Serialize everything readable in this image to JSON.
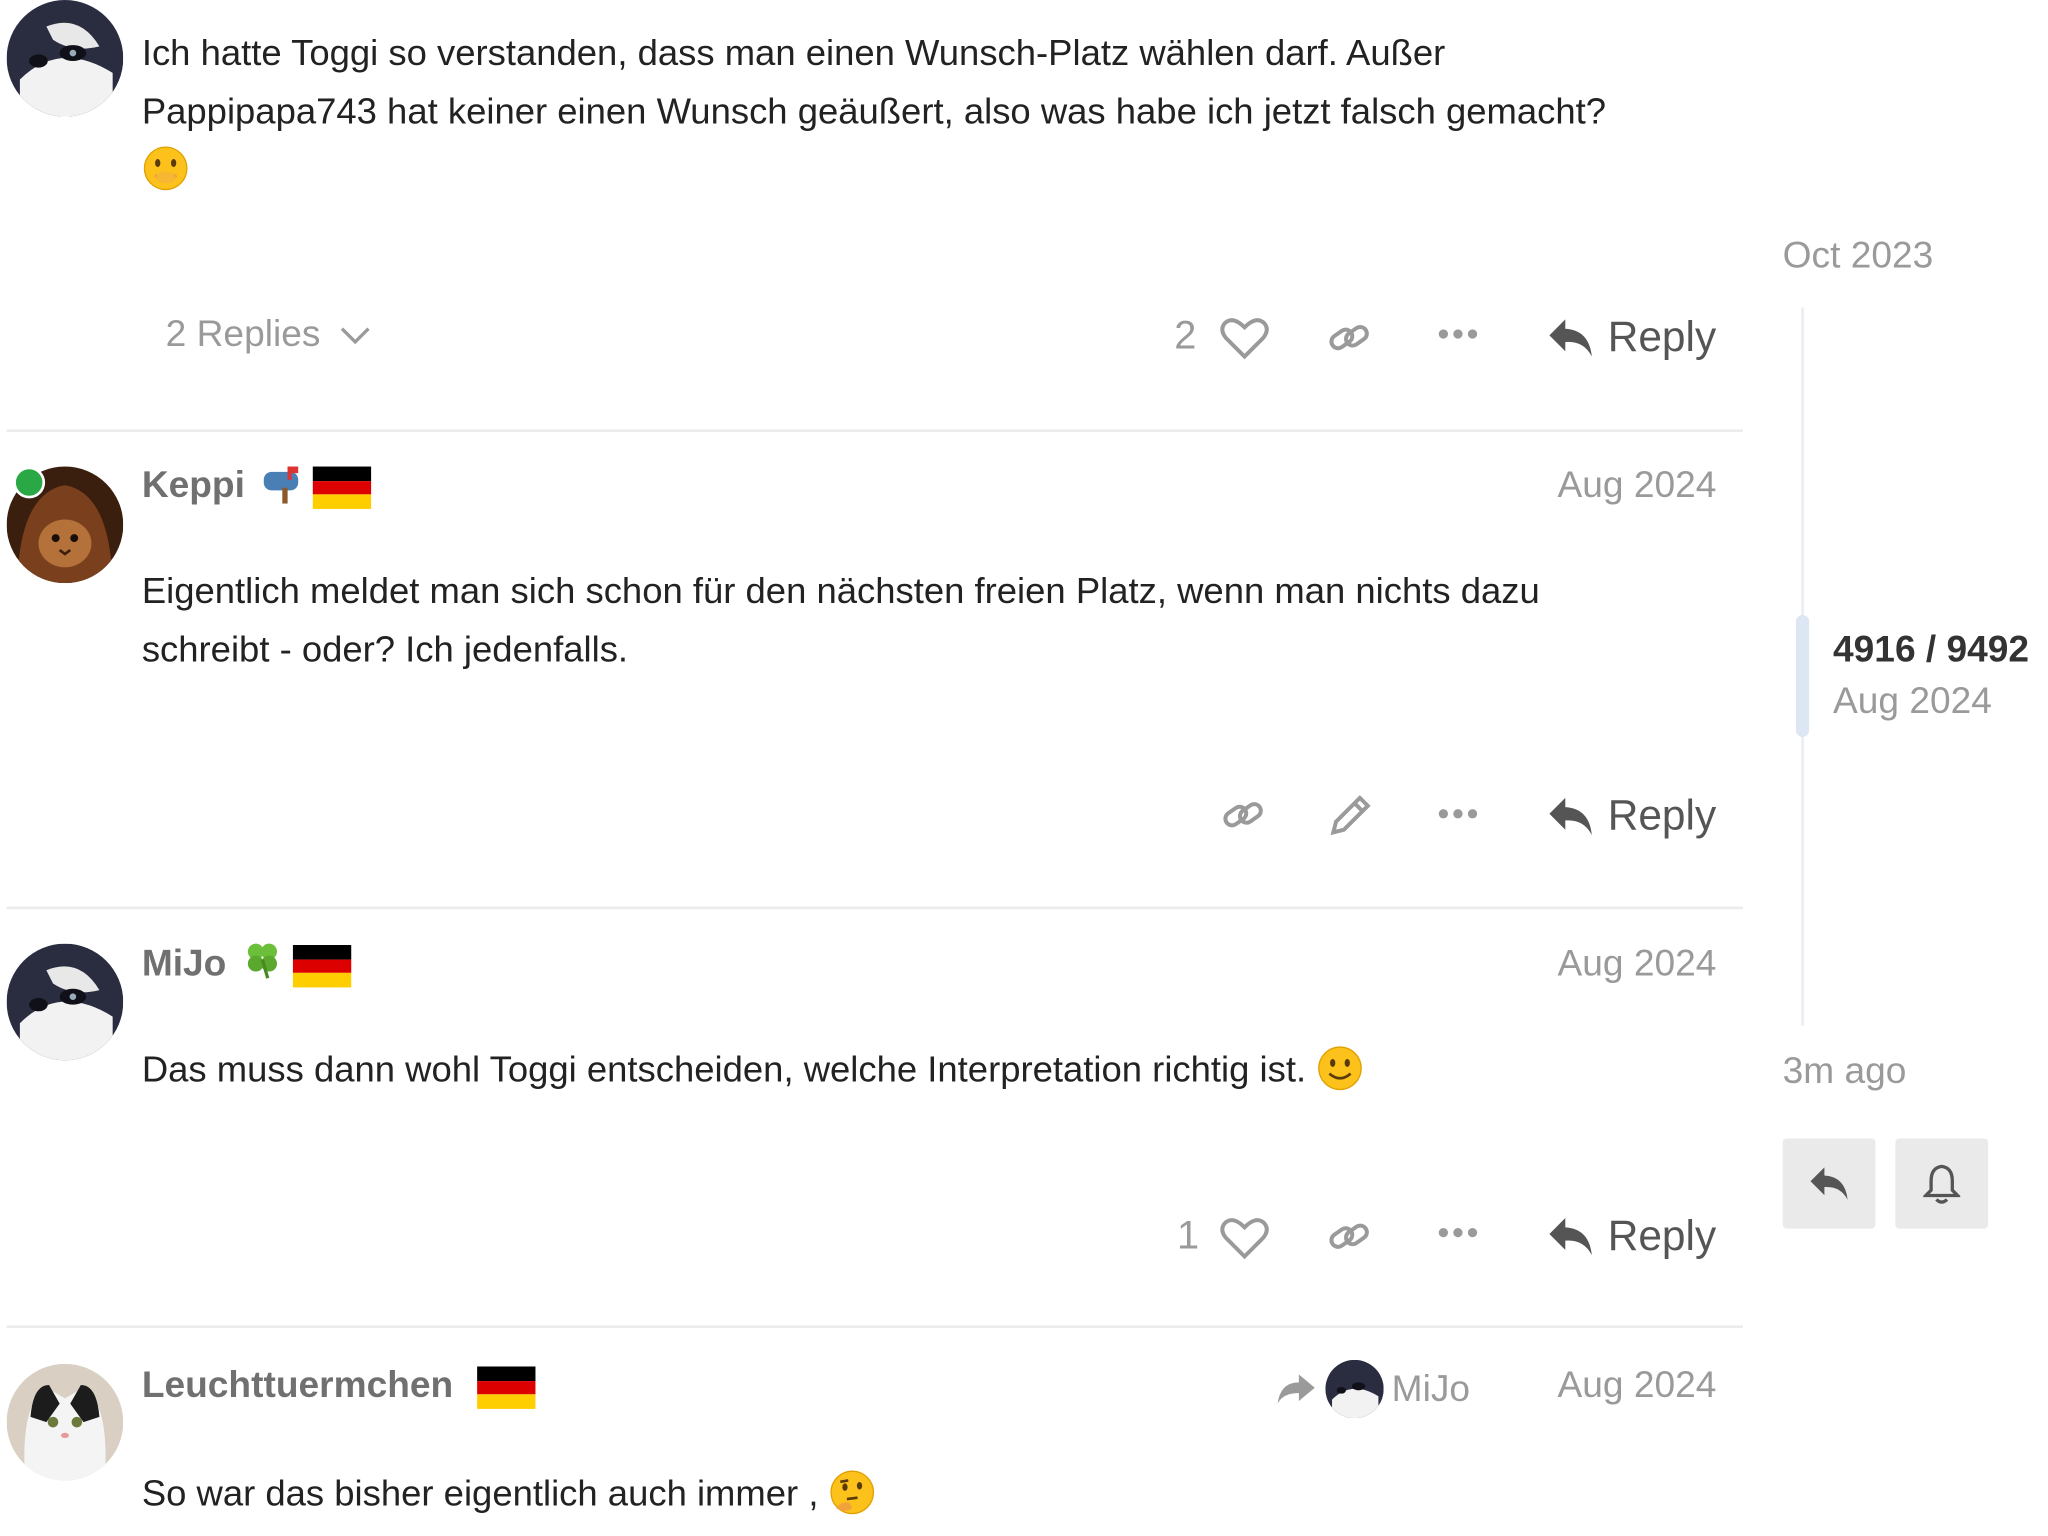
{
  "posts": [
    {
      "text_line1": "Ich hatte Toggi so verstanden, dass man einen Wunsch-Platz wählen darf. Außer",
      "text_line2": "Pappipapa743 hat keiner einen Wunsch geäußert, also was habe ich jetzt falsch gemacht?",
      "emoji": "face-with-hand-over-mouth-icon",
      "replies_label": "2 Replies",
      "like_count": "2",
      "reply_label": "Reply"
    },
    {
      "username": "Keppi",
      "date": "Aug 2024",
      "badge": "mailbox-icon",
      "flag": "german-flag-icon",
      "text_line1": "Eigentlich meldet man sich schon für den nächsten freien Platz, wenn man nichts dazu",
      "text_line2": "schreibt - oder? Ich jedenfalls.",
      "reply_label": "Reply"
    },
    {
      "username": "MiJo",
      "date": "Aug 2024",
      "badge": "clover-icon",
      "flag": "german-flag-icon",
      "text": "Das muss dann wohl Toggi entscheiden, welche Interpretation richtig ist.",
      "emoji": "slightly-smiling-face-icon",
      "like_count": "1",
      "reply_label": "Reply"
    },
    {
      "username": "Leuchttuermchen",
      "date": "Aug 2024",
      "flag": "german-flag-icon",
      "reply_to": "MiJo",
      "text": "So war das bisher eigentlich auch immer ,",
      "emoji": "thinking-face-icon"
    }
  ],
  "timeline": {
    "start_date": "Oct 2023",
    "position": "4916 / 9492",
    "position_date": "Aug 2024",
    "end_label": "3m ago",
    "progress": 0.518
  },
  "colors": {
    "muted": "#9a9a9a",
    "username": "#707070",
    "online": "#2aa845",
    "divider": "#ececec"
  }
}
